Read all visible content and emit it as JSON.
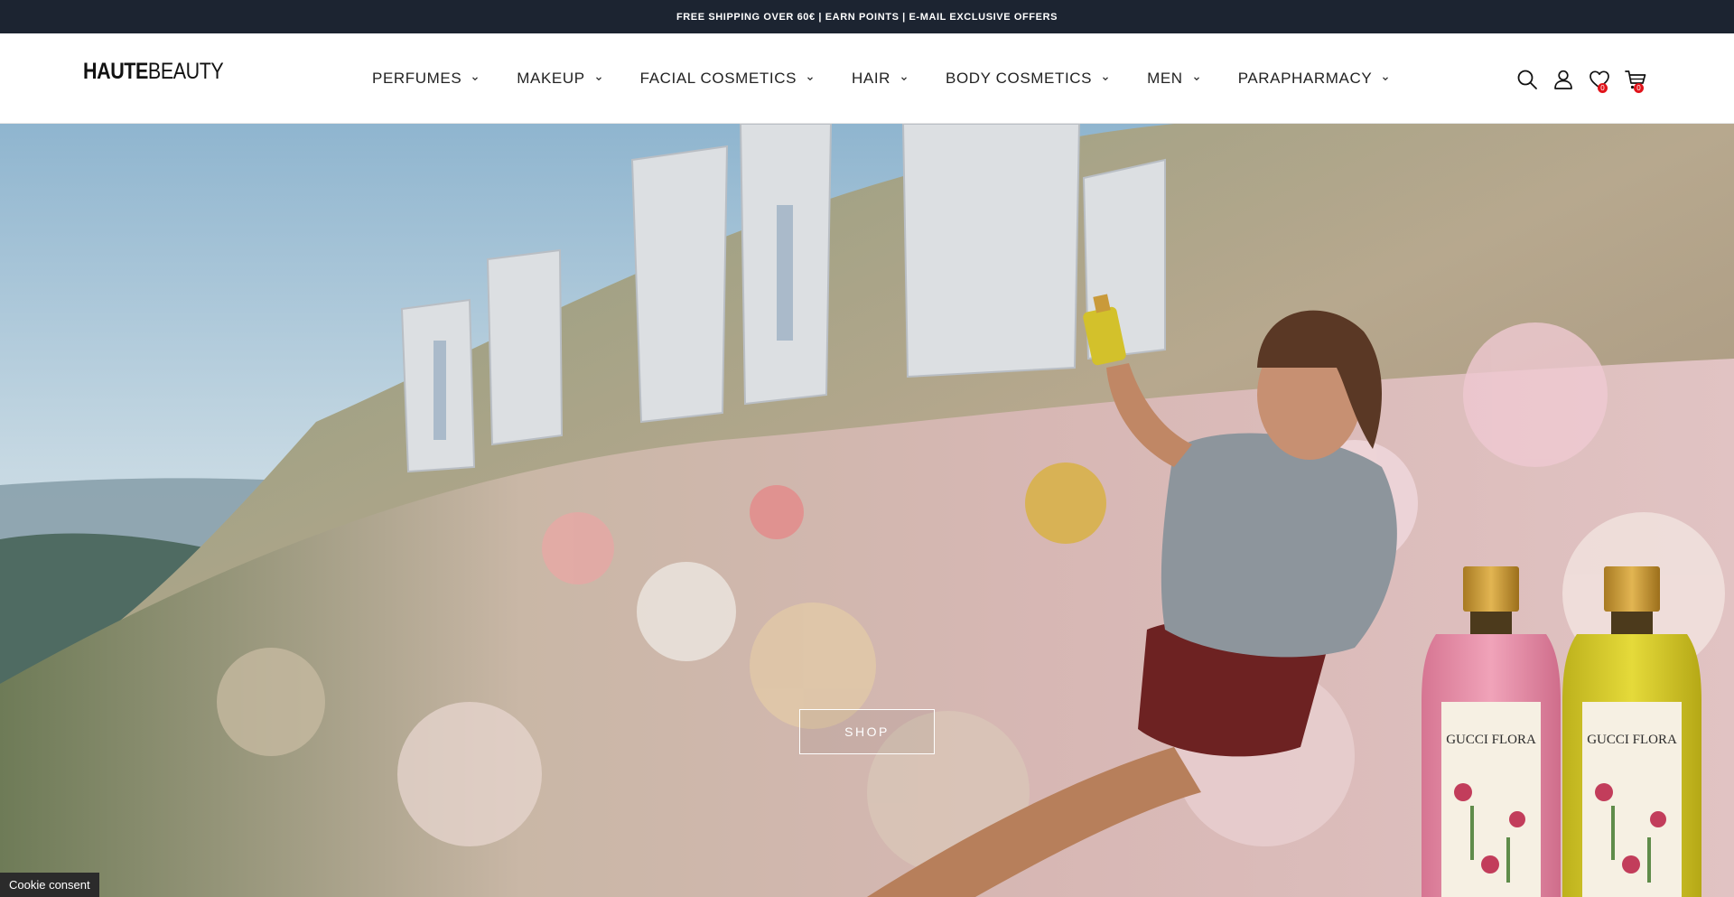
{
  "announcement": "FREE SHIPPING OVER 60€ | EARN POINTS | E-MAIL EXCLUSIVE OFFERS",
  "logo": {
    "bold": "HAUTE",
    "light": "BEAUTY"
  },
  "nav": {
    "items": [
      {
        "label": "PERFUMES"
      },
      {
        "label": "MAKEUP"
      },
      {
        "label": "FACIAL COSMETICS"
      },
      {
        "label": "HAIR"
      },
      {
        "label": "BODY COSMETICS"
      },
      {
        "label": "MEN"
      },
      {
        "label": "PARAPHARMACY"
      }
    ]
  },
  "header_icons": {
    "search": "search-icon",
    "account": "user-icon",
    "wishlist": {
      "icon": "heart-icon",
      "count": "0"
    },
    "cart": {
      "icon": "cart-icon",
      "count": "0"
    }
  },
  "hero": {
    "cta_label": "SHOP",
    "bottle_label_1": "GUCCI FLORA",
    "bottle_label_2": "GUCCI FLORA"
  },
  "cookie_label": "Cookie consent",
  "colors": {
    "topbar": "#1c2431",
    "badge": "#e1141b",
    "bottle_pink": "#e98aa7",
    "bottle_yellow": "#d8cc2a"
  }
}
